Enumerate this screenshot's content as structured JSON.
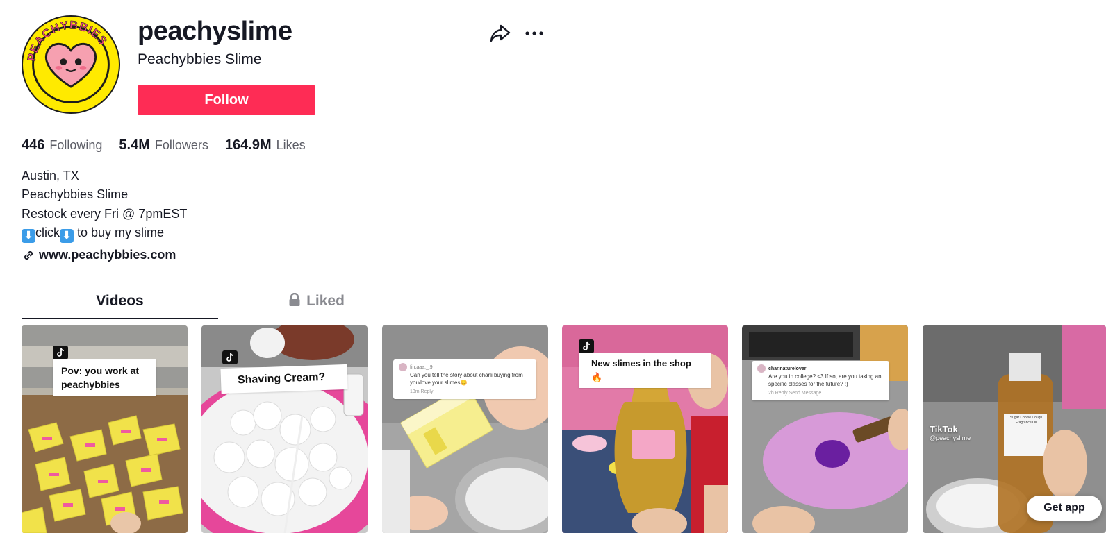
{
  "profile": {
    "username": "peachyslime",
    "nickname": "Peachybbies Slime",
    "follow_label": "Follow",
    "avatar_text": "PEACHYBBIES",
    "stats": [
      {
        "value": "446",
        "label": "Following"
      },
      {
        "value": "5.4M",
        "label": "Followers"
      },
      {
        "value": "164.9M",
        "label": "Likes"
      }
    ],
    "bio": {
      "line1": "Austin, TX",
      "line2": "Peachybbies Slime",
      "line3": "Restock every Fri @ 7pmEST",
      "line4_a": "click",
      "line4_b": "to buy my slime",
      "arrow_glyph": "⬇"
    },
    "link": "www.peachybbies.com"
  },
  "tabs": [
    {
      "label": "Videos",
      "active": true
    },
    {
      "label": "Liked",
      "active": false,
      "icon": "lock-icon"
    }
  ],
  "videos": [
    {
      "caption": "Pov: you work at\npeachybbies",
      "theme": "yellow-boxes"
    },
    {
      "caption": "Shaving Cream?",
      "theme": "white-foam"
    },
    {
      "comment_user": "fin.aaa._.9",
      "comment_text": "Can you tell the story about charli buying from you/love your slimes😊",
      "comment_meta": "13m  Reply",
      "theme": "yellow-slime-tub"
    },
    {
      "caption": "New slimes in the shop 🔥",
      "theme": "piggy-bank-jar"
    },
    {
      "comment_user": "char.naturelover",
      "comment_text": "Are you in college? <3 If so, are you taking an specific classes for the future? :)",
      "comment_meta": "2h   Reply   Send   Message",
      "theme": "purple-slime"
    },
    {
      "watermark_brand": "TikTok",
      "watermark_handle": "@peachyslime",
      "bottle_label": "Sugar Cookie Dough Fragrance Oil",
      "theme": "fragrance-bottle"
    }
  ],
  "get_app_label": "Get app",
  "colors": {
    "accent": "#fe2c55",
    "text": "#161823",
    "muted": "#8a8b91"
  }
}
